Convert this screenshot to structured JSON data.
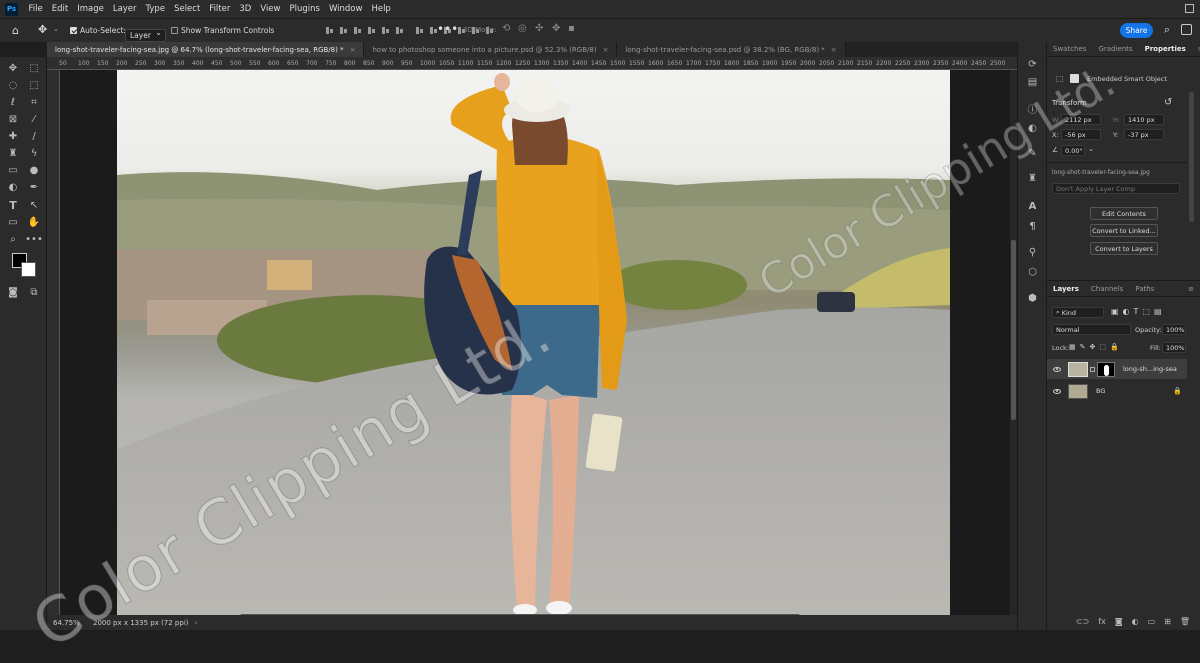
{
  "menu": [
    "File",
    "Edit",
    "Image",
    "Layer",
    "Type",
    "Select",
    "Filter",
    "3D",
    "View",
    "Plugins",
    "Window",
    "Help"
  ],
  "app_logo": "Ps",
  "options": {
    "auto_select_label": "Auto-Select:",
    "auto_select_value": "Layer",
    "transform_label": "Show Transform Controls",
    "mode_label": "3D Mode:",
    "share_label": "Share"
  },
  "tabs": [
    {
      "label": "long-shot-traveler-facing-sea.jpg @ 64.7% (long-shot-traveler-facing-sea, RGB/8) *",
      "active": true
    },
    {
      "label": "how to photoshop someone into a picture.psd @ 52.3% (RGB/8)",
      "active": false
    },
    {
      "label": "long-shot-traveler-facing-sea.psd @ 38.2% (BG, RGB/8) *",
      "active": false
    }
  ],
  "ruler_ticks": [
    "50",
    "100",
    "150",
    "200",
    "250",
    "300",
    "350",
    "400",
    "450",
    "500",
    "550",
    "600",
    "650",
    "700",
    "750",
    "800",
    "850",
    "900",
    "950",
    "1000",
    "1050",
    "1100",
    "1150",
    "1200",
    "1250",
    "1300",
    "1350",
    "1400",
    "1450",
    "1500",
    "1550",
    "1600",
    "1650",
    "1700",
    "1750",
    "1800",
    "1850",
    "1900",
    "1950",
    "2000",
    "2050",
    "2100",
    "2150",
    "2200",
    "2250",
    "2300",
    "2350",
    "2400",
    "2450",
    "2500"
  ],
  "status": {
    "zoom": "64.75%",
    "doc_info": "2000 px x 1335 px (72 ppi)"
  },
  "properties": {
    "tabs": [
      "Swatches",
      "Gradients",
      "Properties"
    ],
    "active_tab": "Properties",
    "object_type": "Embedded Smart Object",
    "section": "Transform",
    "w_label": "W:",
    "w_value": "2112 px",
    "h_label": "H:",
    "h_value": "1410 px",
    "x_label": "X:",
    "x_value": "-56 px",
    "y_label": "Y:",
    "y_value": "-37 px",
    "angle_value": "0.00°",
    "filename": "long-shot-traveler-facing-sea.jpg",
    "comp_placeholder": "Don't Apply Layer Comp",
    "btn_edit": "Edit Contents",
    "btn_linked": "Convert to Linked...",
    "btn_layers": "Convert to Layers"
  },
  "layers": {
    "tabs": [
      "Layers",
      "Channels",
      "Paths"
    ],
    "filter": "Kind",
    "blend": "Normal",
    "opacity_label": "Opacity:",
    "opacity_value": "100%",
    "lock_label": "Lock:",
    "fill_label": "Fill:",
    "fill_value": "100%",
    "items": [
      {
        "name": "long-sh...ing-sea",
        "selected": true
      },
      {
        "name": "BG",
        "selected": false
      }
    ]
  },
  "watermark": "Color Clipping Ltd.",
  "colors": {
    "accent": "#1473e6",
    "panel": "#2b2b2b",
    "sweater": "#e8a21d"
  }
}
